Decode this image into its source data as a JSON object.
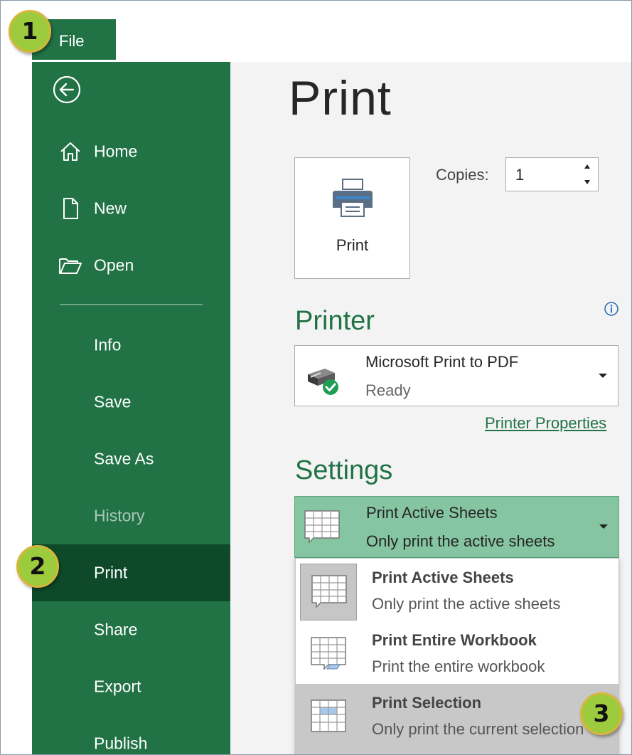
{
  "file_tab": {
    "label": "File"
  },
  "sidebar": {
    "back_icon": "back-arrow-icon",
    "items": [
      {
        "label": "Home",
        "icon": "home-icon",
        "state": "normal"
      },
      {
        "label": "New",
        "icon": "new-document-icon",
        "state": "normal"
      },
      {
        "label": "Open",
        "icon": "folder-open-icon",
        "state": "normal"
      },
      {
        "label": "Info",
        "state": "normal"
      },
      {
        "label": "Save",
        "state": "normal"
      },
      {
        "label": "Save As",
        "state": "normal"
      },
      {
        "label": "History",
        "state": "disabled"
      },
      {
        "label": "Print",
        "state": "selected"
      },
      {
        "label": "Share",
        "state": "normal"
      },
      {
        "label": "Export",
        "state": "normal"
      },
      {
        "label": "Publish",
        "state": "normal"
      }
    ]
  },
  "main": {
    "title": "Print",
    "print_button": {
      "label": "Print",
      "icon": "printer-icon"
    },
    "copies": {
      "label": "Copies:",
      "value": "1"
    },
    "printer_section": {
      "heading": "Printer",
      "info_icon": "info-icon",
      "selected_printer": {
        "name": "Microsoft Print to PDF",
        "status": "Ready",
        "icon": "printer-ready-icon"
      },
      "properties_link": "Printer Properties"
    },
    "settings_section": {
      "heading": "Settings",
      "scope_select": {
        "title": "Print Active Sheets",
        "description": "Only print the active sheets"
      },
      "options": [
        {
          "title": "Print Active Sheets",
          "description": "Only print the active sheets",
          "icon": "sheet-grid-icon"
        },
        {
          "title": "Print Entire Workbook",
          "description": "Print the entire workbook",
          "icon": "workbook-grid-icon"
        },
        {
          "title": "Print Selection",
          "description": "Only print the current selection",
          "icon": "selection-grid-icon"
        }
      ]
    }
  },
  "callouts": [
    "1",
    "2",
    "3"
  ],
  "colors": {
    "brand_green": "#217346",
    "selected_nav": "#0e4a2a",
    "settings_highlight": "#86c5a1",
    "callout_fill": "#9ccc3e",
    "callout_border": "#d9b53a"
  }
}
